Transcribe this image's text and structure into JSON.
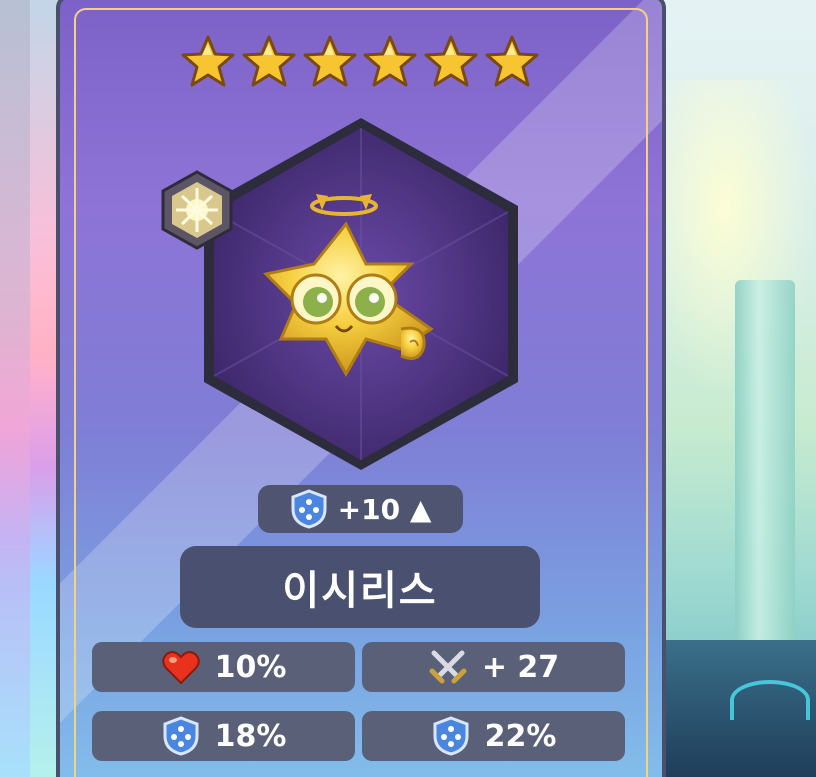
{
  "card": {
    "star_count": 6,
    "enhance_level": "+10 ▲",
    "name": "이시리스",
    "element_icon": "light-element-icon",
    "portrait_icon": "golden-star-creature-icon"
  },
  "stats": [
    {
      "icon": "heart-icon",
      "value": "10%"
    },
    {
      "icon": "crossed-swords-icon",
      "value": "+ 27"
    },
    {
      "icon": "shield-icon",
      "value": "18%"
    },
    {
      "icon": "shield-icon",
      "value": "22%"
    }
  ],
  "colors": {
    "card_top": "#7c61c8",
    "card_bottom": "#83bfeb",
    "star": "#f7c531",
    "plate": "#4a5070",
    "gold_border": "#f4d37e"
  }
}
